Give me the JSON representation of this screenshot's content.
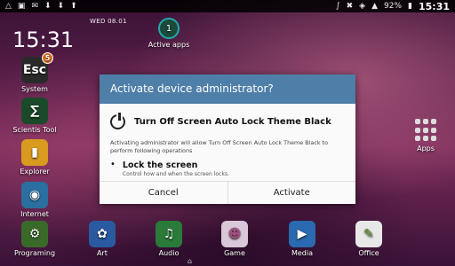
{
  "status_bar": {
    "left_icons": [
      "shield-icon",
      "image-icon",
      "mail-icon",
      "download-icon",
      "download-icon",
      "upload-icon"
    ],
    "battery": "92%",
    "time": "15:31"
  },
  "lockscreen": {
    "date": "WED   08.01",
    "clock": "15:31"
  },
  "active_apps": {
    "count": "1",
    "label": "Active apps"
  },
  "left_apps": [
    {
      "label": "System",
      "badge": "5"
    },
    {
      "label": "Scientis Tool"
    },
    {
      "label": "Explorer"
    },
    {
      "label": "Internet"
    }
  ],
  "right_apps": {
    "label": "Apps"
  },
  "dock": [
    {
      "label": "Programing"
    },
    {
      "label": "Art"
    },
    {
      "label": "Audio"
    },
    {
      "label": "Game"
    },
    {
      "label": "Media"
    },
    {
      "label": "Office"
    }
  ],
  "dialog": {
    "title": "Activate device administrator?",
    "app_name": "Turn Off Screen Auto Lock Theme Black",
    "description": "Activating administrator will allow Turn Off Screen Auto Lock Theme Black to perform following operations",
    "policy_title": "Lock the screen",
    "policy_subtitle": "Control how and when the screen locks.",
    "cancel_label": "Cancel",
    "activate_label": "Activate"
  },
  "colors": {
    "dialog_header": "#4e7fa9",
    "active_ring": "#22aa99",
    "badge": "#e07020"
  }
}
